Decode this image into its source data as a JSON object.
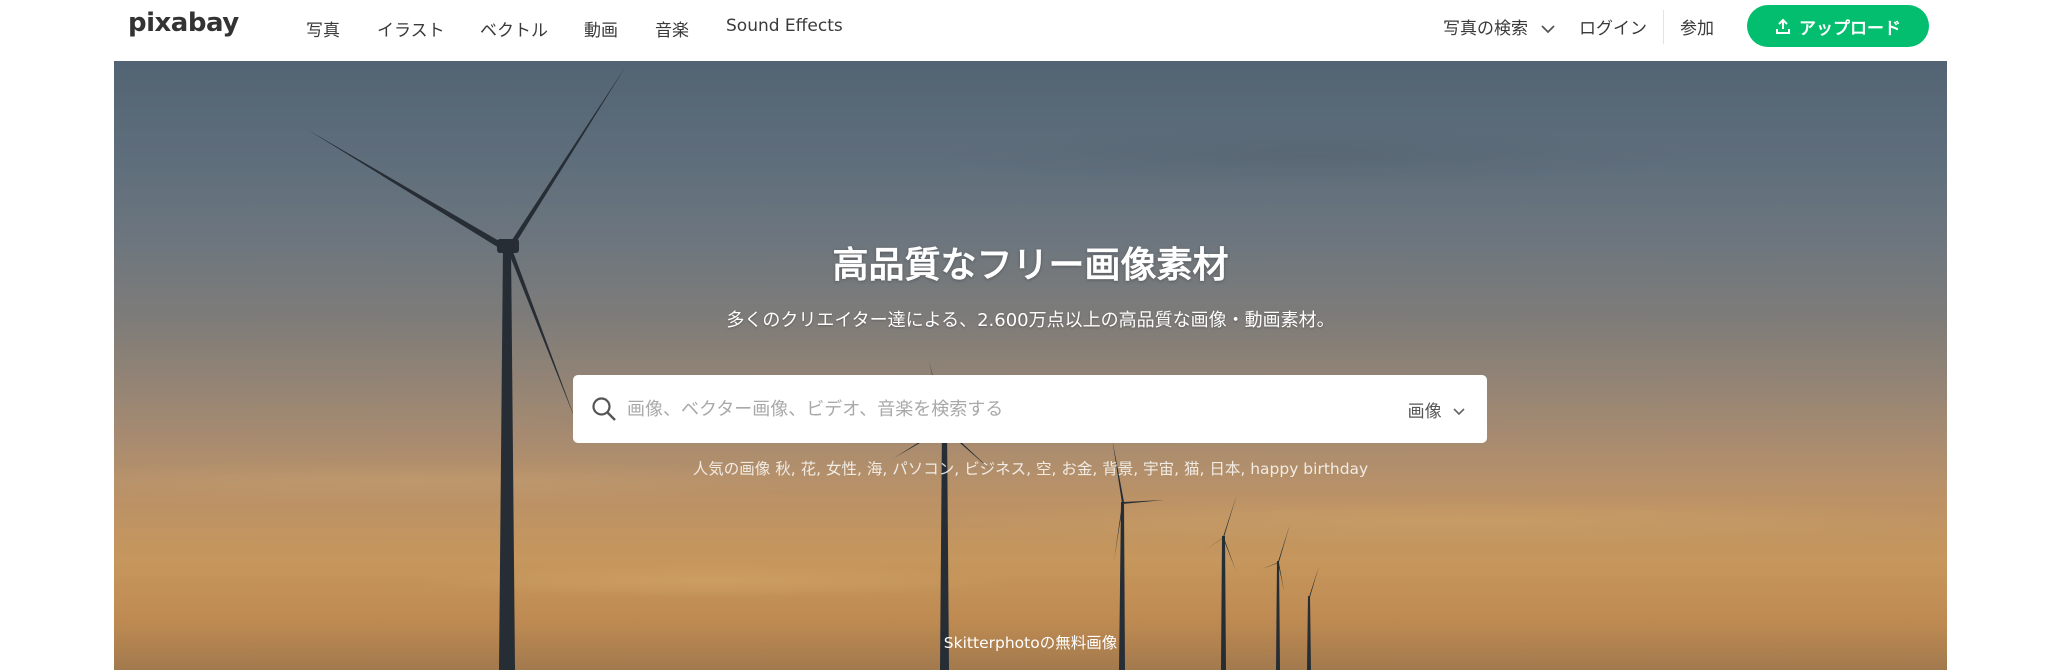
{
  "header": {
    "logo": "pixabay",
    "nav": [
      "写真",
      "イラスト",
      "ベクトル",
      "動画",
      "音楽",
      "Sound Effects"
    ],
    "search_type": "写真の検索",
    "login": "ログイン",
    "join": "参加",
    "upload": "アップロード"
  },
  "hero": {
    "title": "高品質なフリー画像素材",
    "subtitle": "多くのクリエイター達による、2.600万点以上の高品質な画像・動画素材。",
    "search": {
      "placeholder": "画像、ベクター画像、ビデオ、音楽を検索する",
      "value": "",
      "media_type": "画像"
    },
    "popular": {
      "label": "人気の画像",
      "tags": [
        "秋",
        "花",
        "女性",
        "海",
        "パソコン",
        "ビジネス",
        "空",
        "お金",
        "背景",
        "宇宙",
        "猫",
        "日本",
        "happy birthday"
      ]
    },
    "credit": "Skitterphotoの無料画像"
  },
  "colors": {
    "accent": "#02be6e",
    "nav_text": "#3a3a3a",
    "hero_white": "#ffffff"
  },
  "icons": {
    "search": "search-icon",
    "upload": "upload-icon",
    "chevron": "chevron-down-icon"
  }
}
